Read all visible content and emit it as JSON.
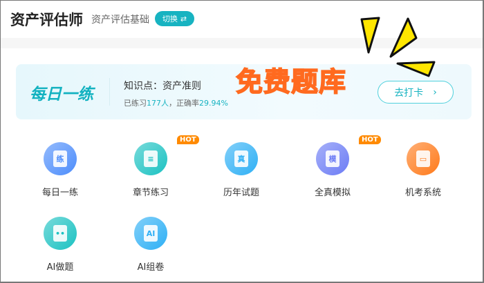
{
  "header": {
    "title": "资产评估师",
    "subtitle": "资产评估基础",
    "switch_label": "切换",
    "switch_icon": "swap-arrows-icon"
  },
  "banner": {
    "daily_title": "每日一练",
    "knowledge_point": "知识点：资产准则",
    "stats_prefix": "已练习",
    "practiced_count": "177人",
    "stats_mid": "，正确率",
    "accuracy": "29.94%",
    "promo_text": "免费题库",
    "checkin_label": "去打卡",
    "checkin_icon": "chevron-right-icon"
  },
  "items": [
    {
      "label": "每日一练",
      "glyph": "练",
      "badge": "",
      "color": "#4d8dfb"
    },
    {
      "label": "章节练习",
      "glyph": "≡",
      "badge": "HOT",
      "color": "#1cc2c2"
    },
    {
      "label": "历年试题",
      "glyph": "真",
      "badge": "",
      "color": "#2fb0f5"
    },
    {
      "label": "全真模拟",
      "glyph": "模",
      "badge": "HOT",
      "color": "#6c7cf5"
    },
    {
      "label": "机考系统",
      "glyph": "▭",
      "badge": "",
      "color": "#ff7a1a"
    },
    {
      "label": "AI做题",
      "glyph": "••",
      "badge": "",
      "color": "#1cc2c2"
    },
    {
      "label": "AI组卷",
      "glyph": "AI",
      "badge": "",
      "color": "#2fb0f5"
    }
  ]
}
